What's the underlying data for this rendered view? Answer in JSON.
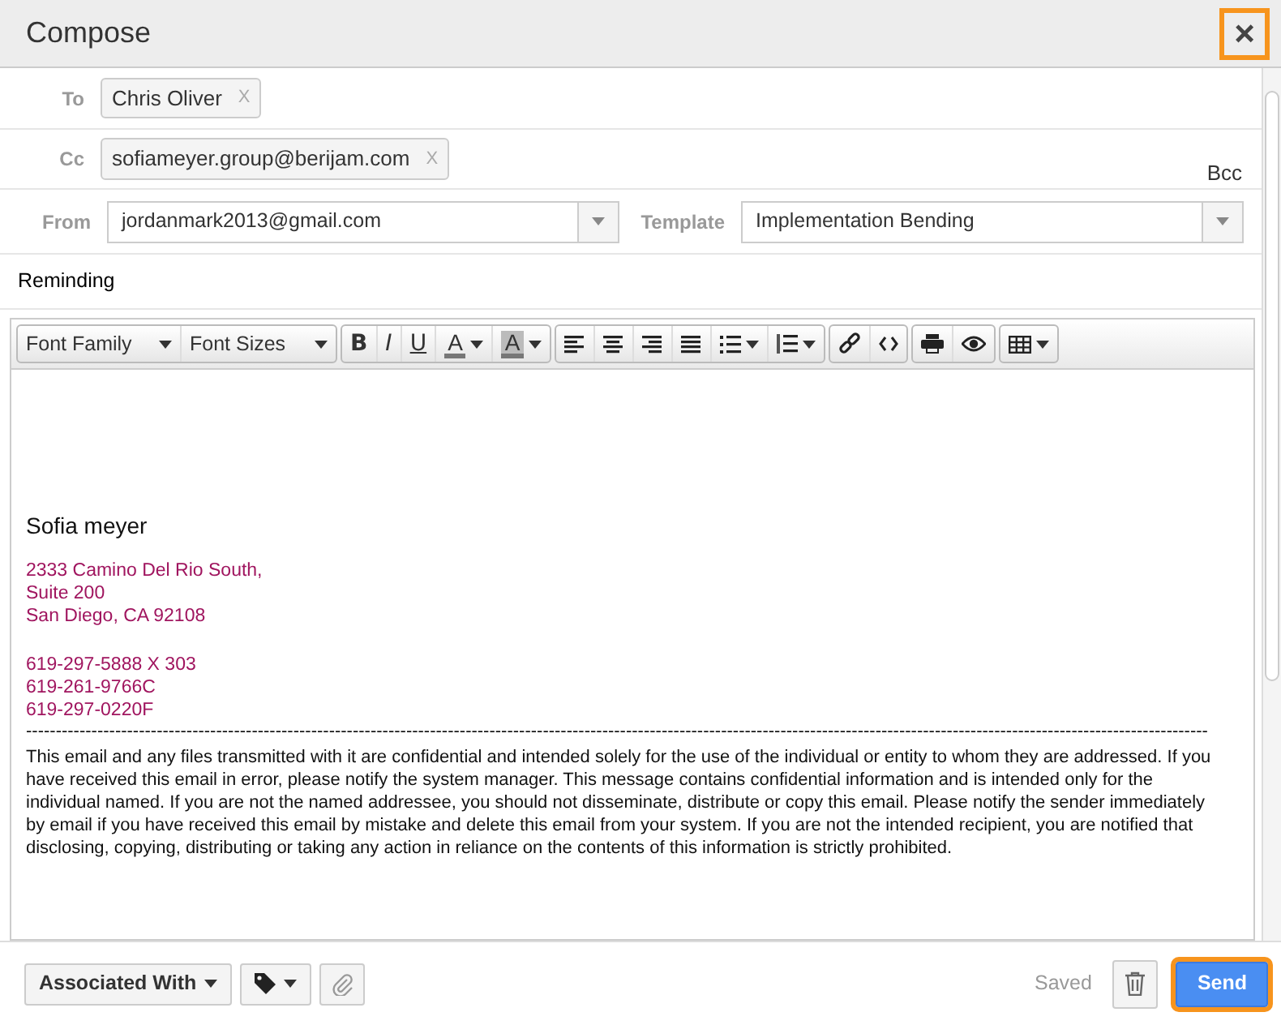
{
  "window": {
    "title": "Compose",
    "close": {
      "label": "×",
      "highlighted": true
    }
  },
  "to": {
    "label": "To",
    "chips": [
      {
        "text": "Chris Oliver",
        "remove": "X"
      }
    ]
  },
  "cc": {
    "label": "Cc",
    "chips": [
      {
        "text": "sofiameyer.group@berijam.com",
        "remove": "X"
      }
    ],
    "bcc": "Bcc"
  },
  "from": {
    "label": "From",
    "value": "jordanmark2013@gmail.com"
  },
  "template": {
    "label": "Template",
    "value": "Implementation Bending"
  },
  "subject": {
    "value": "Reminding"
  },
  "toolbar": [
    [
      {
        "kind": "dropdown",
        "label": "Font Family"
      },
      {
        "kind": "dropdown",
        "label": "Font Sizes"
      }
    ],
    [
      {
        "kind": "bold",
        "label": "B"
      },
      {
        "kind": "italic",
        "label": "I"
      },
      {
        "kind": "underline",
        "label": "U"
      },
      {
        "kind": "forecolor",
        "label": "A"
      },
      {
        "kind": "backcolor",
        "label": "A"
      }
    ],
    [
      {
        "kind": "align-left"
      },
      {
        "kind": "align-center"
      },
      {
        "kind": "align-right"
      },
      {
        "kind": "justify"
      },
      {
        "kind": "bullet-list"
      },
      {
        "kind": "number-list"
      }
    ],
    [
      {
        "kind": "link"
      },
      {
        "kind": "code"
      }
    ],
    [
      {
        "kind": "print"
      },
      {
        "kind": "preview"
      }
    ],
    [
      {
        "kind": "table"
      }
    ]
  ],
  "body": {
    "name": "Sofia meyer",
    "address": [
      "2333 Camino Del Rio South,",
      "Suite 200",
      "San Diego, CA 92108"
    ],
    "phones": [
      "619-297-5888 X 303",
      "619-261-9766C",
      "619-297-0220F"
    ],
    "separator": "-------------------------------------------------------------------------------------------------------------------------------------------------------------------------------------------------------",
    "disclaimer": "This email and any files transmitted with it are confidential and intended solely for the use of the individual or entity to whom they are addressed. If you have received this email in error, please notify the system manager. This message contains confidential information and is intended only for the individual named. If you are not the named addressee, you should not disseminate, distribute or copy this email. Please notify the sender immediately by email if you have received this email by mistake and delete this email from your system. If you are not the intended recipient, you are notified that disclosing, copying, distributing or taking any action in reliance on the contents of this information is strictly prohibited."
  },
  "footer": {
    "associated": "Associated With",
    "status": "Saved",
    "send": {
      "label": "Send",
      "highlighted": true
    }
  }
}
